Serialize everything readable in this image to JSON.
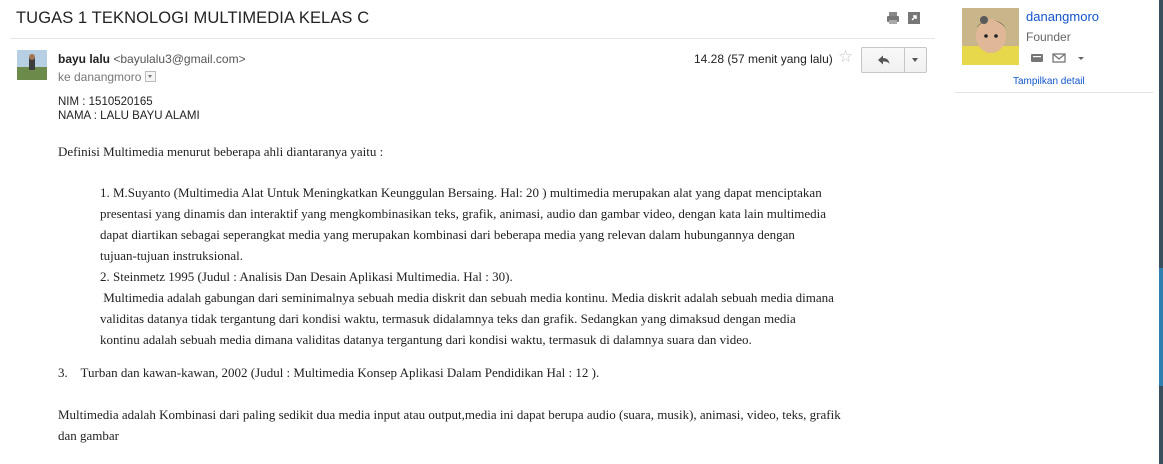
{
  "email": {
    "subject": "TUGAS 1 TEKNOLOGI MULTIMEDIA KELAS C",
    "sender_name": "bayu lalu",
    "sender_email": "<bayulalu3@gmail.com>",
    "to_line": "ke danangmoro",
    "timestamp": "14.28 (57 menit yang lalu)"
  },
  "icons": {
    "print": "print-icon",
    "popout": "open-in-new-window-icon",
    "star": "star-icon",
    "reply": "reply-icon",
    "more": "chevron-down-icon"
  },
  "body": {
    "nim": "NIM : 1510520165",
    "nama": "NAMA : LALU BAYU ALAMI",
    "intro": "Definisi Multimedia menurut beberapa ahli diantaranya yaitu :",
    "item1_lines": [
      "1.    M.Suyanto (Multimedia Alat Untuk Meningkatkan Keunggulan Bersaing. Hal: 20 ) multimedia merupakan alat yang dapat menciptakan",
      "presentasi yang dinamis dan interaktif yang mengkombinasikan teks, grafik, animasi, audio dan gambar video, dengan kata lain multimedia",
      "dapat diartikan sebagai seperangkat media yang merupakan kombinasi dari beberapa media yang relevan dalam hubungannya dengan",
      "tujuan-tujuan instruksional."
    ],
    "item2_title": "2.    Steinmetz 1995 (Judul : Analisis Dan Desain Aplikasi Multimedia. Hal : 30).",
    "item2_lines": [
      " Multimedia adalah gabungan dari seminimalnya sebuah media diskrit dan sebuah media kontinu. Media diskrit adalah sebuah media dimana",
      "validitas datanya tidak tergantung dari kondisi waktu, termasuk didalamnya teks dan grafik. Sedangkan yang dimaksud dengan media",
      "kontinu adalah sebuah media dimana validitas datanya tergantung dari kondisi waktu, termasuk di dalamnya suara dan video."
    ],
    "item3": "3.    Turban dan kawan-kawan, 2002 (Judul : Multimedia Konsep Aplikasi Dalam Pendidikan Hal : 12 ).",
    "closing_lines": [
      "Multimedia adalah Kombinasi dari paling sedikit dua media input atau output,media ini dapat berupa audio (suara, musik), animasi, video, teks, grafik",
      "dan gambar"
    ]
  },
  "sidebar": {
    "name": "danangmoro",
    "role": "Founder",
    "detail_link": "Tampilkan detail",
    "icons": [
      "chat-icon",
      "mail-icon",
      "chevron-down-icon"
    ]
  },
  "colors": {
    "link": "#1155cc",
    "text": "#222222",
    "muted": "#777777",
    "border": "#e5e5e5"
  }
}
